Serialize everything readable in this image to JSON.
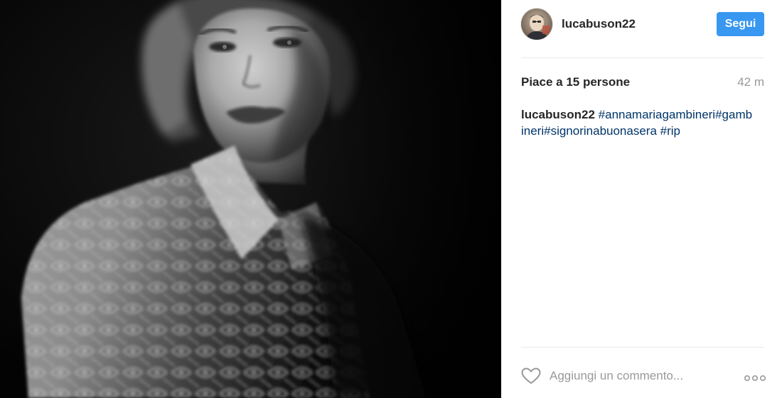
{
  "post": {
    "photo": {
      "alt": "",
      "style": "black-and-white portrait"
    },
    "header": {
      "username": "lucabuson22",
      "follow_label": "Segui",
      "follow_color": "#3897f0"
    },
    "stats": {
      "likes_text": "Piace a 15 persone",
      "timestamp": "42 m"
    },
    "caption": {
      "username": "lucabuson22",
      "hashtags": [
        "#annamariagambineri",
        "#gambineri",
        "#signorinabuonasera",
        "#rip"
      ],
      "hashtag_color": "#003569"
    },
    "comment": {
      "placeholder": "Aggiungi un commento...",
      "like_icon": "heart-outline-icon",
      "more_icon": "more-options-icon"
    }
  }
}
